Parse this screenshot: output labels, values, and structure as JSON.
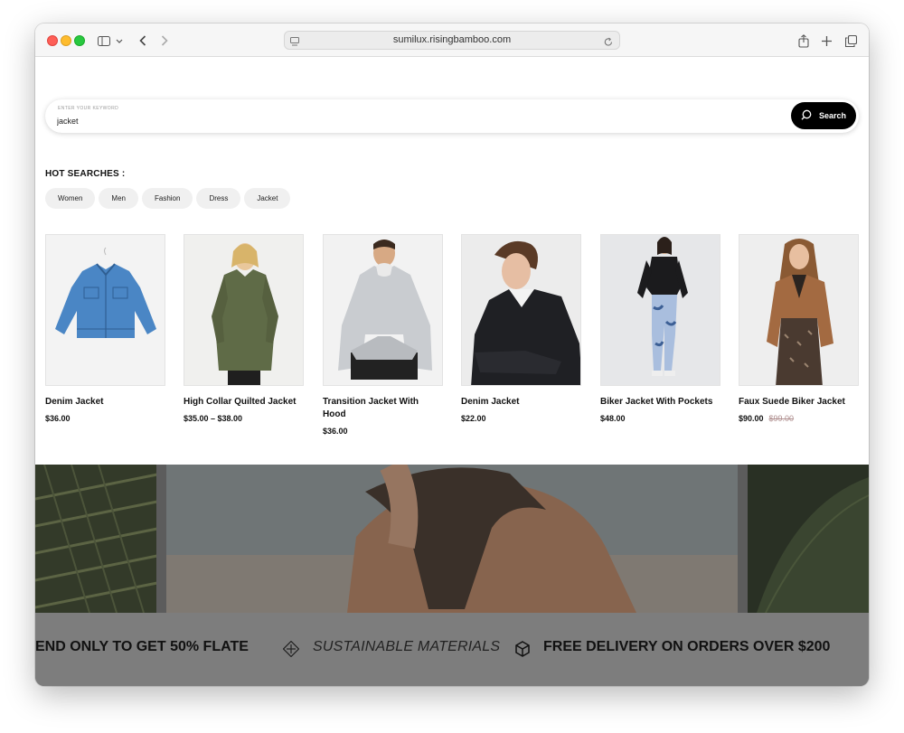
{
  "browser": {
    "url": "sumilux.risingbamboo.com"
  },
  "search": {
    "label": "ENTER YOUR KEYWORD",
    "value": "jacket",
    "button_label": "Search"
  },
  "hot_searches": {
    "title": "HOT SEARCHES :",
    "items": [
      "Women",
      "Men",
      "Fashion",
      "Dress",
      "Jacket"
    ]
  },
  "products": [
    {
      "name": "Denim Jacket",
      "price": "$36.00",
      "old_price": ""
    },
    {
      "name": "High Collar Quilted Jacket",
      "price": "$35.00 – $38.00",
      "old_price": ""
    },
    {
      "name": "Transition Jacket With Hood",
      "price": "$36.00",
      "old_price": ""
    },
    {
      "name": "Denim Jacket",
      "price": "$22.00",
      "old_price": ""
    },
    {
      "name": "Biker Jacket With Pockets",
      "price": "$48.00",
      "old_price": ""
    },
    {
      "name": "Faux Suede Biker Jacket",
      "price": "$90.00",
      "old_price": "$99.00"
    }
  ],
  "marquee": {
    "item1": "END ONLY TO GET 50% FLATE",
    "item2": "SUSTAINABLE MATERIALS",
    "item3": "FREE DELIVERY ON ORDERS OVER $200"
  },
  "colors": {
    "accent": "#000000",
    "chip_bg": "#f0f0f0",
    "old_price": "#b09090"
  }
}
